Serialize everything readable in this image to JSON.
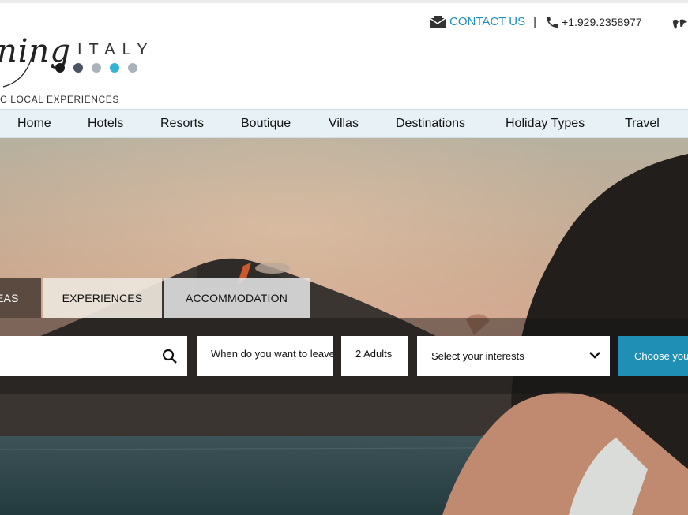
{
  "header": {
    "logo": {
      "script": "ning",
      "word": "ITALY",
      "tagline": "C LOCAL EXPERIENCES",
      "dot_colors": [
        "#1a1a1a",
        "#4a5561",
        "#aab3bb",
        "#35b3d6",
        "#aab3bb"
      ]
    },
    "contact": {
      "label": "CONTACT US",
      "separator": "|",
      "phone": "+1.929.2358977"
    }
  },
  "nav": {
    "items": [
      "Home",
      "Hotels",
      "Resorts",
      "Boutique",
      "Villas",
      "Destinations",
      "Holiday Types",
      "Travel"
    ]
  },
  "search": {
    "tabs": [
      "EAS",
      "EXPERIENCES",
      "ACCOMMODATION"
    ],
    "date_placeholder": "When do you want to leave",
    "adults": "2 Adults",
    "interests": "Select your interests",
    "button": "Choose you"
  },
  "colors": {
    "accent": "#1f8fb5",
    "link": "#1e8fbf",
    "nav_bg": "#e8f2f6"
  },
  "icons": [
    "envelope-icon",
    "phone-icon",
    "globe-icon",
    "search-icon",
    "chevron-down-icon"
  ]
}
